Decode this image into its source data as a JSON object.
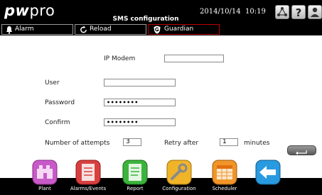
{
  "header": {
    "logo_prefix": "pw",
    "logo_suffix": "pro",
    "title": "SMS configuration",
    "date": "2014/10/14",
    "time": "10:19"
  },
  "tabs": [
    {
      "label": "Alarm",
      "icon": "bell-icon"
    },
    {
      "label": "Reload",
      "icon": "reload-icon"
    },
    {
      "label": "Guardian",
      "icon": "guardian-icon",
      "accent": "#c00000"
    }
  ],
  "form": {
    "ip_modem": {
      "label": "IP Modem",
      "value": ""
    },
    "user": {
      "label": "User",
      "value": ""
    },
    "password": {
      "label": "Password",
      "value": "••••••••"
    },
    "confirm": {
      "label": "Confirm",
      "value": "••••••••"
    },
    "attempts": {
      "label": "Number of attempts",
      "value": "3"
    },
    "retry": {
      "label": "Retry after",
      "value": "1",
      "unit": "minutes"
    }
  },
  "nav": [
    {
      "label": "Plant",
      "icon": "plant-icon",
      "color": "#c85ac8"
    },
    {
      "label": "Alarms/Events",
      "icon": "alarms-events-icon",
      "color": "#d84040"
    },
    {
      "label": "Report",
      "icon": "report-icon",
      "color": "#3cb43c"
    },
    {
      "label": "Configuration",
      "icon": "configuration-icon",
      "color": "#f0b428"
    },
    {
      "label": "Scheduler",
      "icon": "scheduler-icon",
      "color": "#f09628"
    },
    {
      "label": "",
      "icon": "back-arrow-icon",
      "color": "#2a9ae0"
    }
  ]
}
